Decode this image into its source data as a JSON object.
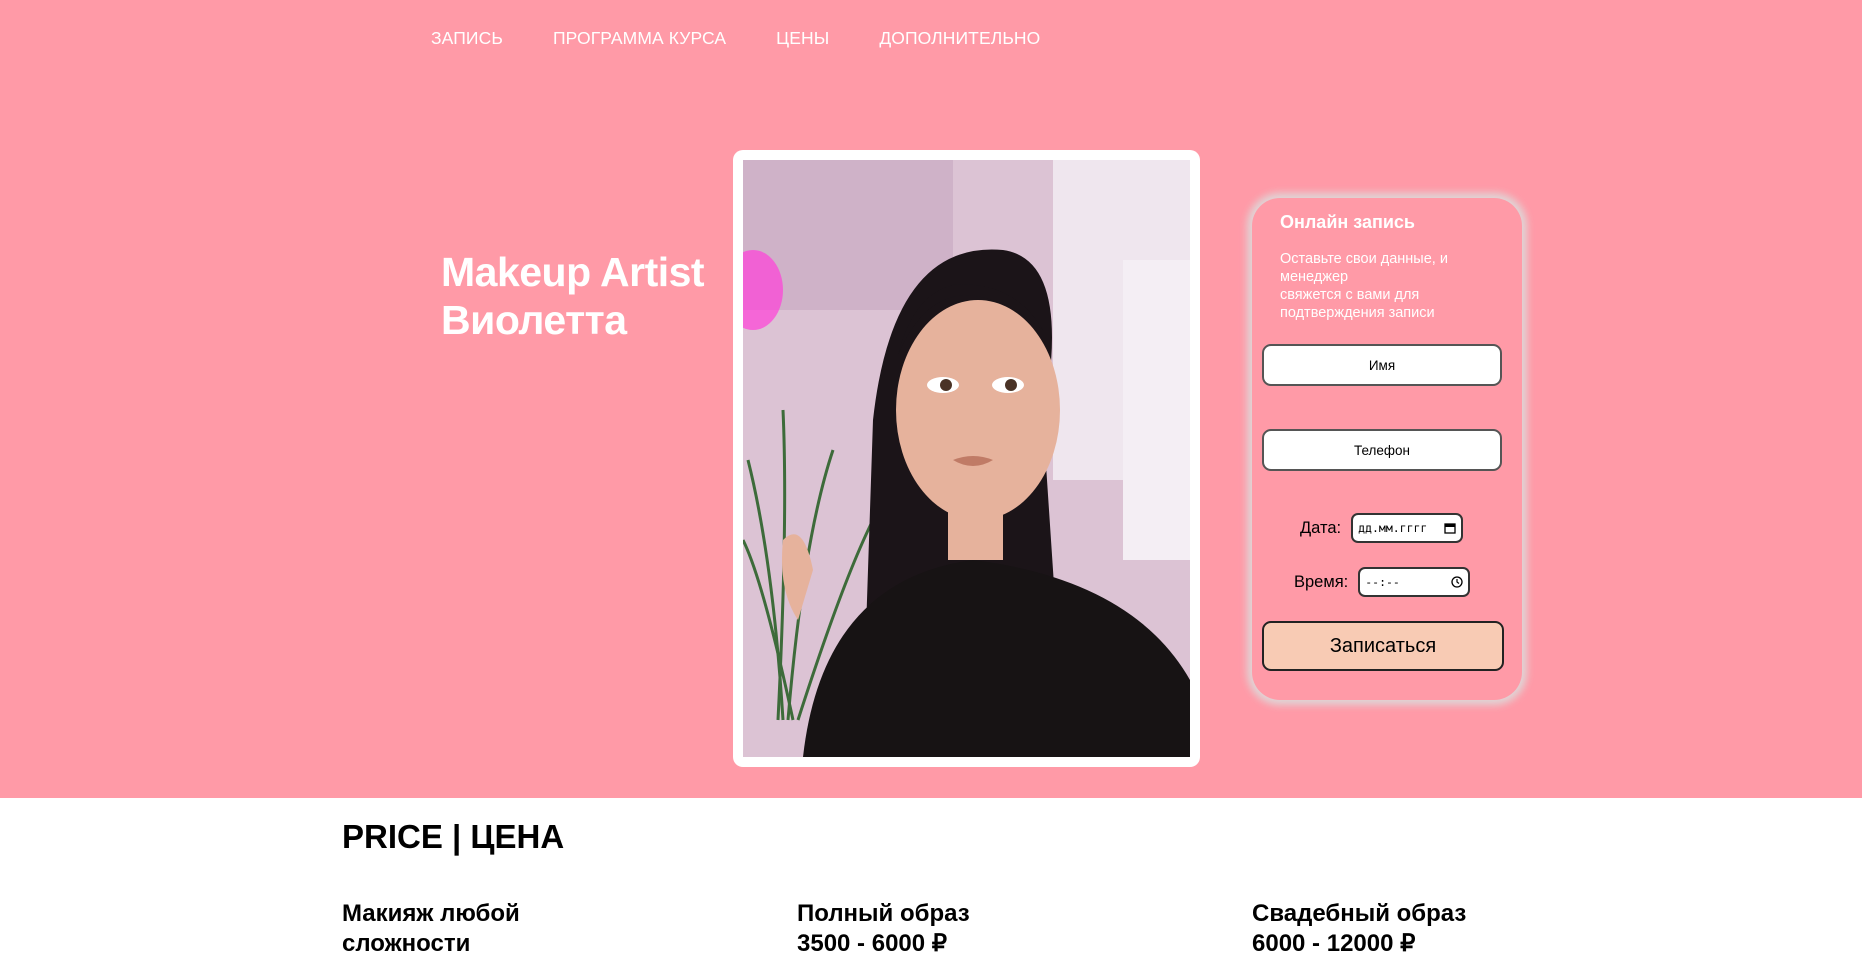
{
  "nav": {
    "items": [
      {
        "label": "ЗАПИСЬ"
      },
      {
        "label": "ПРОГРАММА КУРСА"
      },
      {
        "label": "ЦЕНЫ"
      },
      {
        "label": "ДОПОЛНИТЕЛЬНО"
      }
    ]
  },
  "hero": {
    "title_line1": "Makeup Artist",
    "title_line2": "Виолетта"
  },
  "form": {
    "title": "Онлайн запись",
    "desc_line1": "Оставьте свои данные, и",
    "desc_line2": "менеджер",
    "desc_line3": "свяжется с вами для",
    "desc_line4": "подтверждения записи",
    "name_placeholder": "Имя",
    "phone_placeholder": "Телефон",
    "date_label": "Дата:",
    "date_placeholder": "дд.мм.гггг",
    "time_label": "Время:",
    "time_placeholder": "--:--",
    "submit_label": "Записаться"
  },
  "price": {
    "title": "PRICE | ЦЕНА",
    "items": [
      {
        "name_line1": "Макияж любой",
        "name_line2": "сложности"
      },
      {
        "name_line1": "Полный образ",
        "name_line2": "3500 - 6000 ₽"
      },
      {
        "name_line1": "Свадебный образ",
        "name_line2": "6000 - 12000 ₽"
      }
    ]
  },
  "colors": {
    "hero_bg": "#ff9aa7",
    "button_bg": "#f8cbb4"
  }
}
